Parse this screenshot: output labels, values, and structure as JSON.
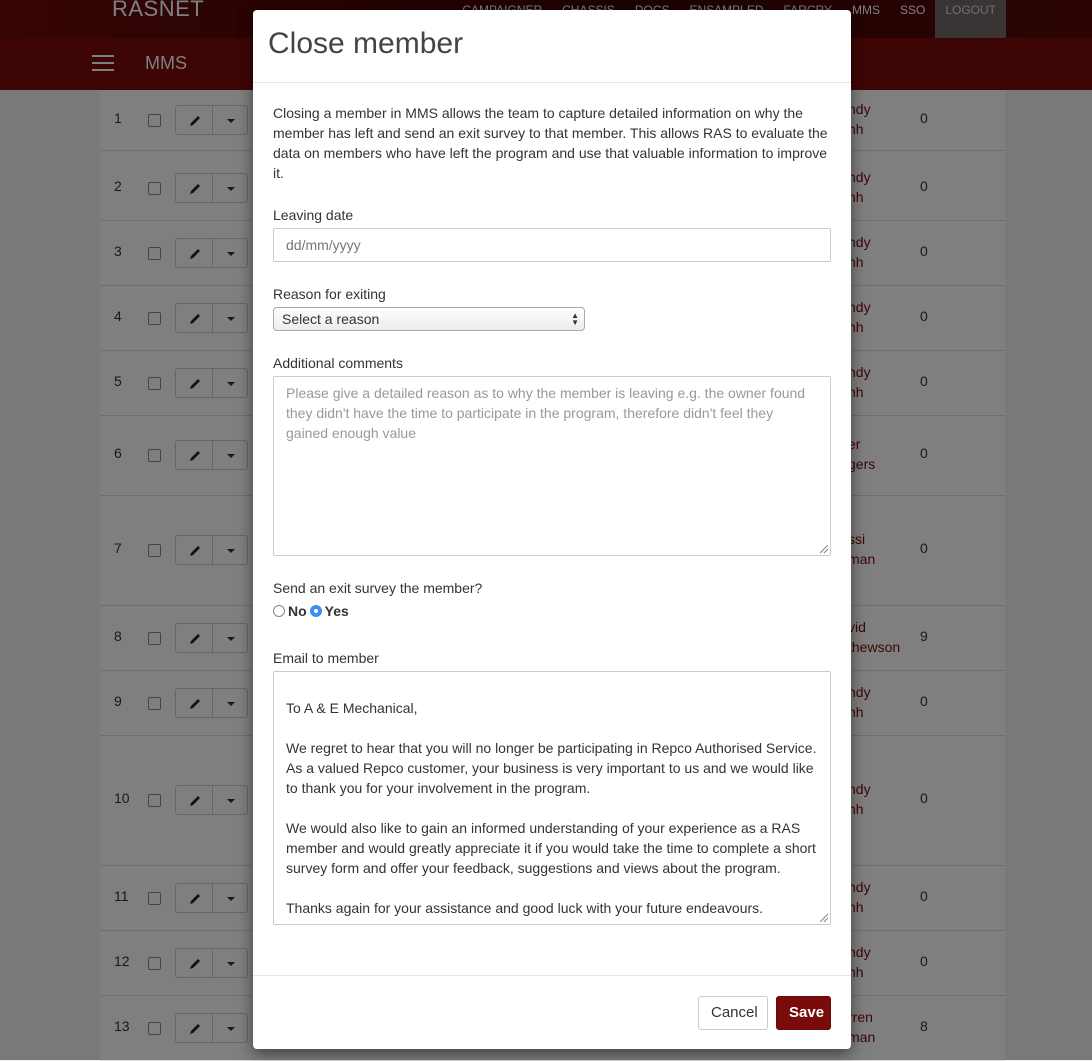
{
  "app": {
    "brand": "RASNET",
    "section": "MMS"
  },
  "topnav": [
    "CAMPAIGNER",
    "CHASSIS",
    "DOCS",
    "ENSAMPLED",
    "FARCRY",
    "MMS",
    "SSO"
  ],
  "topnav_logout": "LOGOUT",
  "rows": [
    {
      "num": "1",
      "name": [
        "ndy",
        "nh"
      ],
      "count": "0"
    },
    {
      "num": "2",
      "name": [
        "ndy",
        "nh"
      ],
      "count": "0"
    },
    {
      "num": "3",
      "name": [
        "ndy",
        "nh"
      ],
      "count": "0"
    },
    {
      "num": "4",
      "name": [
        "ndy",
        "nh"
      ],
      "count": "0"
    },
    {
      "num": "5",
      "name": [
        "ndy",
        "nh"
      ],
      "count": "0"
    },
    {
      "num": "6",
      "name": [
        "er",
        "gers"
      ],
      "count": "0"
    },
    {
      "num": "7",
      "name": [
        "ssi",
        "man"
      ],
      "count": "0"
    },
    {
      "num": "8",
      "name": [
        "vid",
        "thewson"
      ],
      "count": "9"
    },
    {
      "num": "9",
      "name": [
        "ndy",
        "nh"
      ],
      "count": "0"
    },
    {
      "num": "10",
      "name": [
        "ndy",
        "nh"
      ],
      "count": "0"
    },
    {
      "num": "11",
      "name": [
        "ndy",
        "nh"
      ],
      "count": "0"
    },
    {
      "num": "12",
      "name": [
        "ndy",
        "nh"
      ],
      "count": "0"
    },
    {
      "num": "13",
      "name": [
        "rren",
        "man"
      ],
      "count": "8"
    }
  ],
  "modal": {
    "title": "Close member",
    "intro": "Closing a member in MMS allows the team to capture detailed information on why the member has left and send an exit survey to that member. This allows RAS to evaluate the data on members who have left the program and use that valuable information to improve it.",
    "leaving_date_label": "Leaving date",
    "leaving_date_placeholder": "dd/mm/yyyy",
    "reason_label": "Reason for exiting",
    "reason_selected": "Select a reason",
    "comments_label": "Additional comments",
    "comments_placeholder": "Please give a detailed reason as to why the member is leaving e.g. the owner found they didn't have the time to participate in the program, therefore didn't feel they gained enough value",
    "survey_label": "Send an exit survey the member?",
    "survey_no": "No",
    "survey_yes": "Yes",
    "survey_value": "Yes",
    "email_label": "Email to member",
    "email_body": "To A & E Mechanical,\n\nWe regret to hear that you will no longer be participating in Repco Authorised Service. As a valued Repco customer, your business is very important to us and we would like to thank you for your involvement in the program.\n\nWe would also like to gain an informed understanding of your experience as a RAS member and would greatly appreciate it if you would take the time to complete a short survey form and offer your feedback, suggestions and views about the program.\n\nThanks again for your assistance and good luck with your future endeavours.",
    "cancel_label": "Cancel",
    "save_label": "Save"
  },
  "colors": {
    "brand": "#7a0b0b",
    "radio_selected": "#3a8ff0"
  }
}
